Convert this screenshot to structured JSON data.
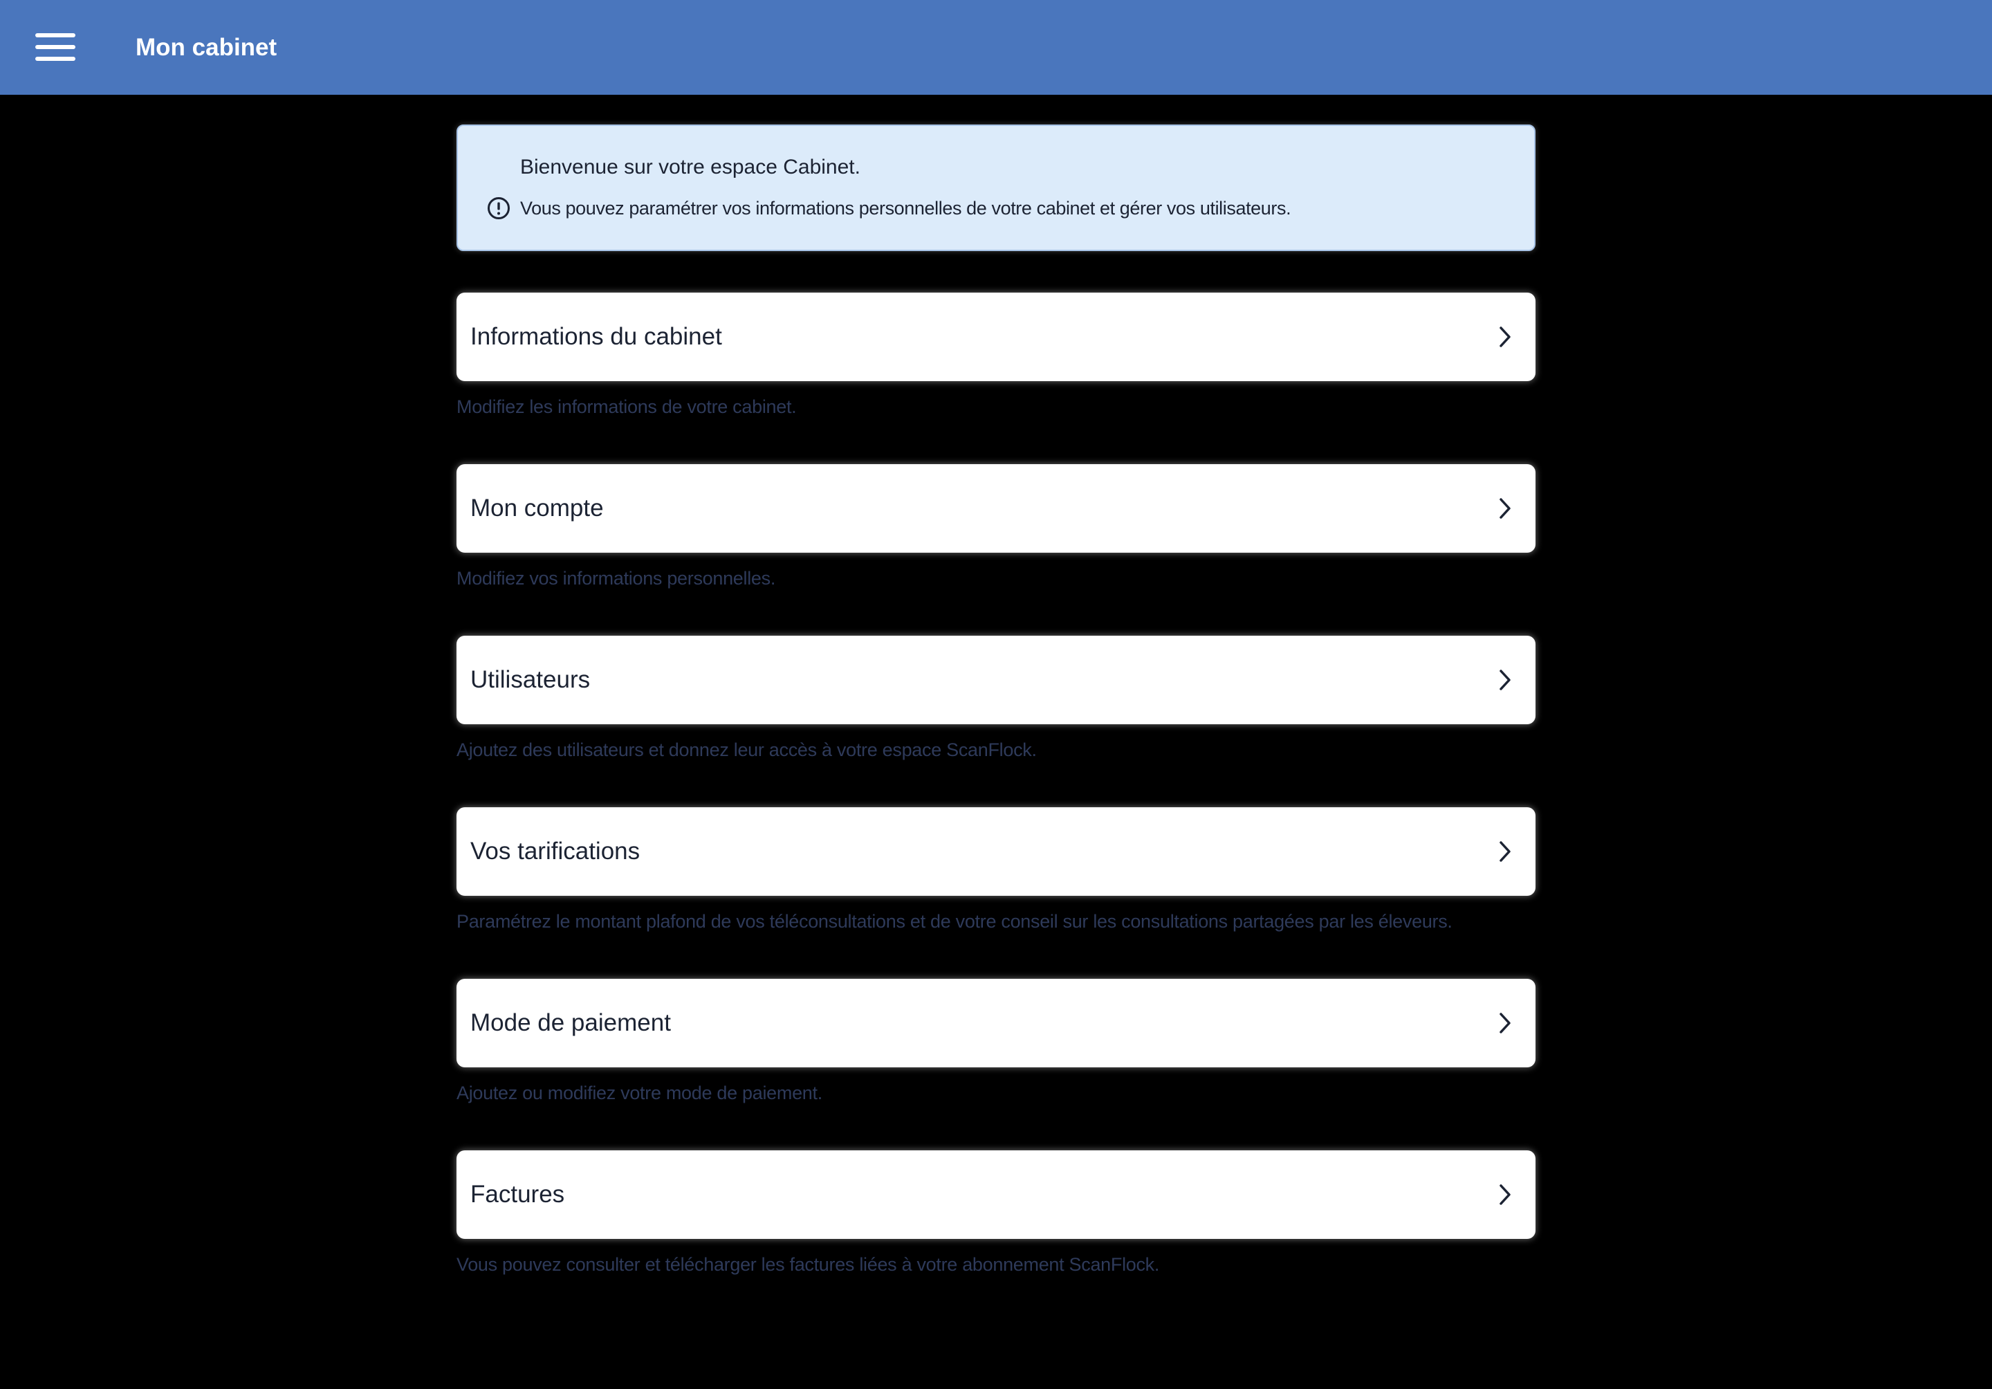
{
  "header": {
    "menu_icon": "hamburger-menu-icon",
    "title": "Mon cabinet"
  },
  "banner": {
    "title": "Bienvenue sur votre espace Cabinet.",
    "icon": "info-circle-icon",
    "text": "Vous pouvez paramétrer vos informations personnelles de votre cabinet et gérer vos utilisateurs."
  },
  "sections": [
    {
      "label": "Informations du cabinet",
      "description": "Modifiez les informations de votre cabinet."
    },
    {
      "label": "Mon compte",
      "description": "Modifiez vos informations personnelles."
    },
    {
      "label": "Utilisateurs",
      "description": "Ajoutez des utilisateurs et donnez leur accès à votre espace ScanFlock."
    },
    {
      "label": "Vos tarifications",
      "description": "Paramétrez le montant plafond de vos téléconsultations et de votre conseil sur les consultations partagées par les éleveurs."
    },
    {
      "label": "Mode de paiement",
      "description": "Ajoutez ou modifiez votre mode de paiement."
    },
    {
      "label": "Factures",
      "description": "Vous pouvez consulter et télécharger les factures liées à votre abonnement ScanFlock."
    }
  ],
  "colors": {
    "header_background": "#4a76bd",
    "page_background": "#000000",
    "banner_background": "#dcebfa",
    "card_background": "#ffffff",
    "description_text": "#2e3a5a"
  }
}
